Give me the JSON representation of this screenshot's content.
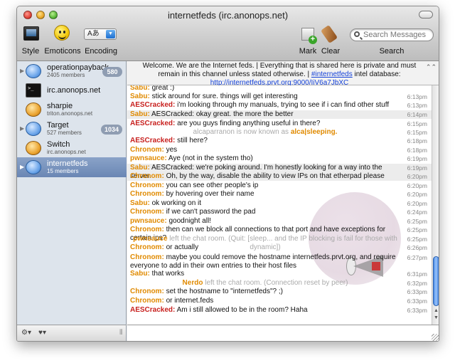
{
  "window": {
    "title": "internetfeds (irc.anonops.net)"
  },
  "toolbar": {
    "style_label": "Style",
    "emoticons_label": "Emoticons",
    "encoding_label": "Encoding",
    "encoding_value": "Aあ",
    "mark_label": "Mark",
    "clear_label": "Clear",
    "search_label": "Search",
    "search_placeholder": "Search Messages"
  },
  "sidebar": {
    "items": [
      {
        "name": "operationpayback",
        "sub": "2405 members",
        "count": "580",
        "icon": "chat-bubble-icon"
      },
      {
        "name": "irc.anonops.net",
        "sub": "",
        "count": "",
        "icon": "terminal-icon"
      },
      {
        "name": "sharpie",
        "sub": "triton.anonops.net",
        "count": "",
        "icon": "user-bubble-icon"
      },
      {
        "name": "Target",
        "sub": "527 members",
        "count": "1034",
        "icon": "chat-bubble-icon"
      },
      {
        "name": "Switch",
        "sub": "irc.anonops.net",
        "count": "",
        "icon": "user-bubble-icon"
      },
      {
        "name": "internetfeds",
        "sub": "15 members",
        "count": "",
        "icon": "chat-bubble-icon",
        "selected": true
      }
    ]
  },
  "topic": {
    "text": "Welcome. We are the Internet feds. | Everything that is shared here is private and must remain in this channel unless stated otherwise. |",
    "link1": "#internetfeds",
    "text2": "intel database:",
    "link2": "http://internetfeds.prvt.org:9000/IiV6a7JbXC"
  },
  "colors": {
    "nick_orange": "#e08a00",
    "nick_red": "#c8201e",
    "selection_blue": "#6a86b4",
    "link_blue": "#1542d8"
  },
  "messages": [
    {
      "nick": "Sabu:",
      "text": "great :)",
      "time": "",
      "color": "#e08a00"
    },
    {
      "nick": "Sabu:",
      "text": "stick around for sure. things will get interesting",
      "time": "6:13pm",
      "color": "#e08a00"
    },
    {
      "nick": "AESCracked:",
      "text": "i'm looking through my manuals, trying to see if i can find other stuff",
      "time": "6:13pm",
      "color": "#c8201e"
    },
    {
      "nick": "Sabu:",
      "text": "AESCracked: okay great. the more the better",
      "time": "6:14pm",
      "color": "#e08a00",
      "hl": true
    },
    {
      "nick": "AESCracked:",
      "text": "are you guys finding anything useful in there?",
      "time": "6:15pm",
      "color": "#c8201e"
    },
    {
      "status": true,
      "text": "alcaparranon is now known as",
      "nick": "alca|sleeping.",
      "time": "6:15pm"
    },
    {
      "nick": "AESCracked:",
      "text": "still here?",
      "time": "6:18pm",
      "color": "#c8201e"
    },
    {
      "nick": "Chronom:",
      "text": "yes",
      "time": "6:18pm",
      "color": "#e08a00"
    },
    {
      "nick": "pwnsauce:",
      "text": "Aye (not in the system tho)",
      "time": "6:19pm",
      "color": "#e08a00"
    },
    {
      "nick": "Sabu:",
      "text": "AESCracked: we're poking around. I'm honestly looking for a way into the server.",
      "time": "6:19pm",
      "color": "#e08a00",
      "hl": true
    },
    {
      "nick": "Chronom:",
      "text": "Oh, by the way, disable the ability to view IPs on that etherpad please",
      "time": "6:20pm",
      "color": "#e08a00"
    },
    {
      "nick": "Chronom:",
      "text": "you can see other people's ip",
      "time": "6:20pm",
      "color": "#e08a00"
    },
    {
      "nick": "Chronom:",
      "text": "by hovering over their name",
      "time": "6:20pm",
      "color": "#e08a00"
    },
    {
      "nick": "Sabu:",
      "text": "ok working on it",
      "time": "6:20pm",
      "color": "#e08a00"
    },
    {
      "nick": "Chronom:",
      "text": "if we can't password the pad",
      "time": "6:24pm",
      "color": "#e08a00"
    },
    {
      "nick": "pwnsauce:",
      "text": "goodnight all!",
      "time": "6:25pm",
      "color": "#e08a00"
    },
    {
      "nick": "Chronom:",
      "text": "then can we block all connections to that port and have exceptions for certain ips?",
      "time": "6:25pm",
      "color": "#e08a00"
    },
    {
      "status": true,
      "nick": "pwnsauce",
      "text": "left the chat room. (Quit: [sleep... and the IP blocking is fail for those with dynamic])",
      "time": "6:25pm",
      "leave": true
    },
    {
      "nick": "Chronom:",
      "text": "or actually",
      "time": "6:26pm",
      "color": "#e08a00"
    },
    {
      "nick": "Chronom:",
      "text": "maybe you could remove the hostname internetfeds.prvt.org, and require everyone to add in their own entries to their host files",
      "time": "6:27pm",
      "color": "#e08a00"
    },
    {
      "nick": "Sabu:",
      "text": "that works",
      "time": "6:31pm",
      "color": "#e08a00"
    },
    {
      "status": true,
      "nick": "Nerdo",
      "text": "left the chat room. (Connection reset by peer)",
      "time": "6:32pm",
      "leave": true
    },
    {
      "nick": "Chronom:",
      "text": "set the hostname to \"internetfeds\"? ;)",
      "time": "6:33pm",
      "color": "#e08a00"
    },
    {
      "nick": "Chronom:",
      "text": "or internet.feds",
      "time": "6:33pm",
      "color": "#e08a00"
    },
    {
      "nick": "AESCracked:",
      "text": "Am i still allowed to be in the room? Haha",
      "time": "6:33pm",
      "color": "#c8201e"
    }
  ],
  "input": {
    "value": ""
  }
}
